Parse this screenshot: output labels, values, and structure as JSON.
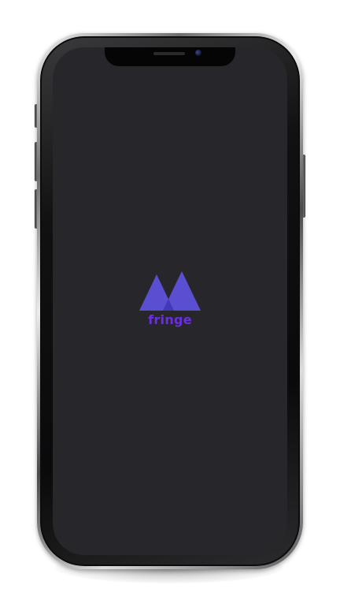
{
  "app": {
    "name": "fringe"
  },
  "theme": {
    "screen_background": "#27272b",
    "logo_primary": "#5b4fd1",
    "logo_shadow": "#4338b8",
    "wordmark_color": "#6a2fe0"
  },
  "device": {
    "model": "phone-mockup"
  },
  "splash": {
    "logo_icon": "fringe-logo-icon",
    "wordmark": "fringe"
  }
}
